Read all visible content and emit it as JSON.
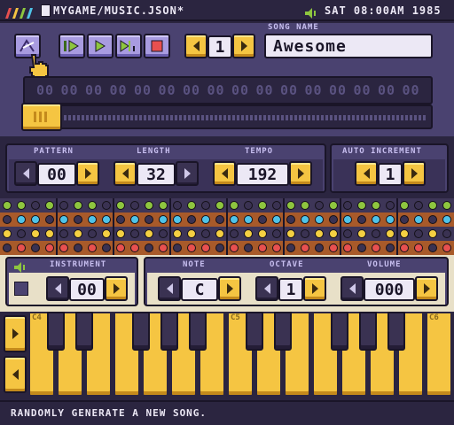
{
  "topbar": {
    "file_path": "MYGAME/MUSIC.JSON*",
    "clock": "SAT 08:00AM 1985"
  },
  "transport": {
    "song_index": "1"
  },
  "song_name": {
    "label": "SONG NAME",
    "value": "Awesome"
  },
  "patterns_row": [
    "00",
    "00",
    "00",
    "00",
    "00",
    "00",
    "00",
    "00",
    "00",
    "00",
    "00",
    "00",
    "00",
    "00",
    "00",
    "00"
  ],
  "pattern_panel": {
    "pattern_label": "PATTERN",
    "pattern_value": "00",
    "length_label": "LENGTH",
    "length_value": "32",
    "tempo_label": "TEMPO",
    "tempo_value": "192"
  },
  "auto_increment": {
    "label": "AUTO INCREMENT",
    "value": "1"
  },
  "instrument_panel": {
    "label": "INSTRUMENT",
    "value": "00"
  },
  "note_panel": {
    "note_label": "NOTE",
    "note_value": "C",
    "octave_label": "OCTAVE",
    "octave_value": "1",
    "volume_label": "VOLUME",
    "volume_value": "000"
  },
  "keyboard": {
    "octave_labels": [
      "C4",
      "C5",
      "C6"
    ]
  },
  "status": {
    "message": "RANDOMLY GENERATE A NEW SONG."
  },
  "colors": {
    "yellow": "#f5c542",
    "purple": "#a89be0",
    "dark": "#2b2540",
    "dot_green": "#8ec63f",
    "dot_cyan": "#4fc3e8",
    "dot_orange": "#e8a04f",
    "dot_red": "#e8504f",
    "dot_yellow": "#f5d042"
  }
}
